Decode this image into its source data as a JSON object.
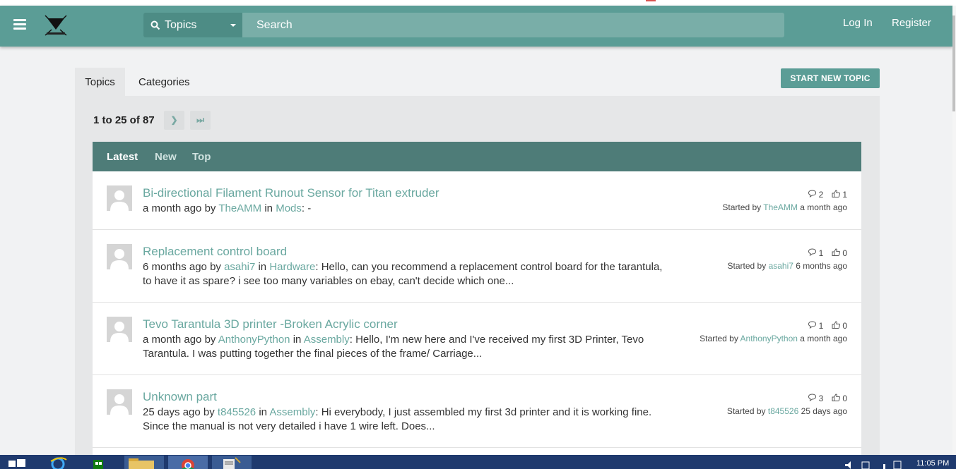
{
  "header": {
    "search_category": "Topics",
    "search_placeholder": "Search",
    "login_label": "Log In",
    "register_label": "Register"
  },
  "tabs": [
    {
      "label": "Topics",
      "active": true
    },
    {
      "label": "Categories",
      "active": false
    }
  ],
  "start_new_topic_label": "START NEW TOPIC",
  "pagination": {
    "range_text": "1 to 25 of 87",
    "next_symbol": "❯",
    "last_symbol": "⏭"
  },
  "filters": [
    {
      "label": "Latest",
      "active": true
    },
    {
      "label": "New",
      "active": false
    },
    {
      "label": "Top",
      "active": false
    }
  ],
  "topics": [
    {
      "title": "Bi-directional Filament Runout Sensor for Titan extruder",
      "when": "a month ago",
      "by_word": "by",
      "author": "TheAMM",
      "in_word": "in",
      "category": "Mods",
      "excerpt": ": -",
      "replies": "2",
      "likes": "1",
      "started_prefix": "Started by",
      "started_when": "a month ago"
    },
    {
      "title": "Replacement control board",
      "when": "6 months ago",
      "by_word": "by",
      "author": "asahi7",
      "in_word": "in",
      "category": "Hardware",
      "excerpt": ": Hello, can you recommend a replacement control board for the tarantula, to have it as spare? i see too many variables on ebay, can't decide which one...",
      "replies": "1",
      "likes": "0",
      "started_prefix": "Started by",
      "started_when": "6 months ago"
    },
    {
      "title": "Tevo Tarantula 3D printer -Broken Acrylic corner",
      "when": "a month ago",
      "by_word": "by",
      "author": "AnthonyPython",
      "in_word": "in",
      "category": "Assembly",
      "excerpt": ": Hello, I'm new here and I've received my first 3D Printer, Tevo Tarantula. I was putting together the final pieces of the frame/ Carriage...",
      "replies": "1",
      "likes": "0",
      "started_prefix": "Started by",
      "started_when": "a month ago"
    },
    {
      "title": "Unknown part",
      "when": "25 days ago",
      "by_word": "by",
      "author": "t845526",
      "in_word": "in",
      "category": "Assembly",
      "excerpt": ": Hi everybody, I just assembled my first 3d printer and it is working fine. Since the manual is not very detailed i have 1 wire left. Does...",
      "replies": "3",
      "likes": "0",
      "started_prefix": "Started by",
      "started_when": "25 days ago"
    }
  ],
  "taskbar": {
    "clock": "11:05 PM"
  },
  "colors": {
    "header": "#5b9d96",
    "filter_bar": "#4e7c78",
    "link": "#6aa8a0"
  }
}
